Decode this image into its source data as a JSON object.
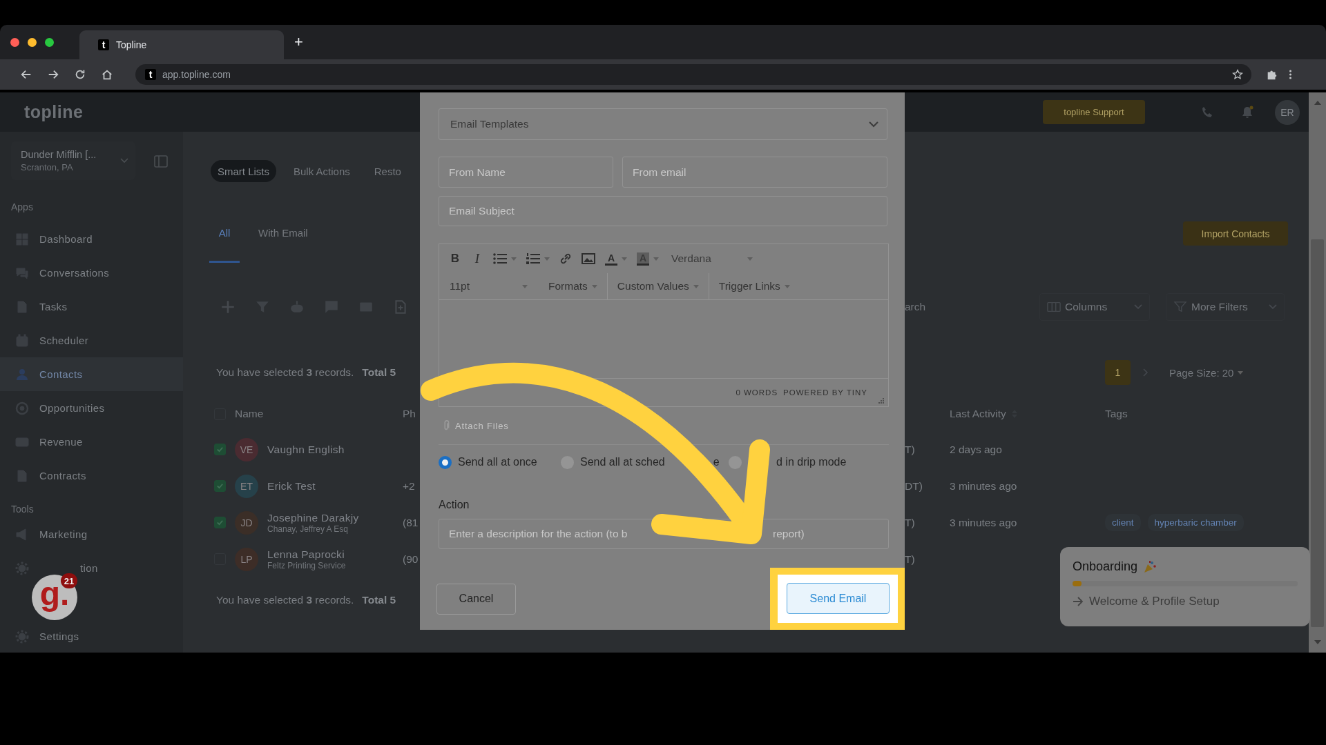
{
  "browser": {
    "tab": {
      "favicon": "t",
      "title": "Topline",
      "selected": true
    },
    "new_tab": "+",
    "address": {
      "favicon": "t",
      "url": "app.topline.com"
    }
  },
  "header": {
    "logo": "topline",
    "support_button": "topline Support",
    "avatar": "ER"
  },
  "sidebar": {
    "location": {
      "name": "Dunder Mifflin [...",
      "address": "Scranton, PA"
    },
    "sections": [
      {
        "title": "Apps",
        "items": [
          {
            "label": "Dashboard",
            "selected": false
          },
          {
            "label": "Conversations",
            "selected": false
          },
          {
            "label": "Tasks",
            "selected": false
          },
          {
            "label": "Scheduler",
            "selected": false
          },
          {
            "label": "Contacts",
            "selected": true
          },
          {
            "label": "Opportunities",
            "selected": false
          },
          {
            "label": "Revenue",
            "selected": false
          },
          {
            "label": "Contracts",
            "selected": false
          }
        ]
      },
      {
        "title": "Tools",
        "items": [
          {
            "label": "Marketing",
            "selected": false,
            "kind": "full"
          },
          {
            "label": "tion",
            "selected": false,
            "kind": "tail"
          }
        ]
      }
    ],
    "settings": "Settings"
  },
  "helper_badge": {
    "letter": "g.",
    "count": "21"
  },
  "contacts": {
    "views": [
      {
        "label": "Smart Lists",
        "selected": true
      },
      {
        "label": "Bulk Actions",
        "selected": false
      },
      {
        "label": "Resto",
        "selected": false
      }
    ],
    "list_tabs": [
      {
        "label": "All",
        "selected": true
      },
      {
        "label": "With Email",
        "selected": false
      }
    ],
    "import_button": "Import Contacts",
    "search": {
      "placeholder": "arch"
    },
    "columns_button": "Columns",
    "filters_button": "More Filters",
    "summary_top": {
      "text": "You have selected **3** records.",
      "total": "Total 5"
    },
    "pagination": {
      "pages": [
        {
          "label": "1",
          "selected": true
        }
      ],
      "page_size": "Page Size: 20"
    },
    "table": {
      "all_selected": false,
      "columns": [
        "Name",
        "Ph",
        "Last Activity",
        "Tags"
      ],
      "rows": [
        {
          "selected": true,
          "initials": "VE",
          "color": "#4a2b31",
          "name": "Vaughn English",
          "timezone": "T)",
          "last_activity": "2 days ago"
        },
        {
          "selected": true,
          "initials": "ET",
          "color": "#26414a",
          "name": "Erick Test",
          "phone": "+2",
          "timezone": "DT)",
          "last_activity": "3 minutes ago"
        },
        {
          "selected": true,
          "initials": "JD",
          "color": "#3b2e27",
          "name": "Josephine Darakjy",
          "company": "Chanay, Jeffrey A Esq",
          "phone": "(81",
          "timezone": "T)",
          "last_activity": "3 minutes ago",
          "tags": [
            "client",
            "hyperbaric chamber"
          ]
        },
        {
          "selected": false,
          "initials": "LP",
          "color": "#3d2d27",
          "name": "Lenna Paprocki",
          "company": "Feltz Printing Service",
          "phone": "(90",
          "timezone": "T)"
        }
      ]
    },
    "summary_bottom": {
      "text": "You have selected **3** records.",
      "total": "Total 5"
    }
  },
  "email_modal": {
    "template_select": "Email Templates",
    "from_name": {
      "placeholder": "From Name"
    },
    "from_email": {
      "placeholder": "From email"
    },
    "subject": {
      "placeholder": "Email Subject"
    },
    "editor": {
      "bold": "B",
      "italic": "I",
      "text_color": "A",
      "highlight_color": "A",
      "font": "Verdana",
      "font_size": "11pt",
      "menus": [
        "Formats",
        "Custom Values",
        "Trigger Links"
      ],
      "word_count": "0 WORDS",
      "powered_by": "POWERED BY TINY"
    },
    "attach": "Attach Files",
    "send_modes": [
      {
        "label": "Send all at once",
        "selected": true
      },
      {
        "label": "Send all at sched",
        "tail": "e",
        "selected": false
      },
      {
        "label": "d in drip mode",
        "selected": false
      }
    ],
    "action": {
      "label": "Action",
      "placeholder": "Enter a description for the action (to b",
      "placeholder_tail": "report)"
    },
    "cancel": "Cancel",
    "send": "Send Email"
  },
  "onboarding": {
    "title": "Onboarding",
    "level": 0.04,
    "next_step": "Welcome & Profile Setup"
  }
}
